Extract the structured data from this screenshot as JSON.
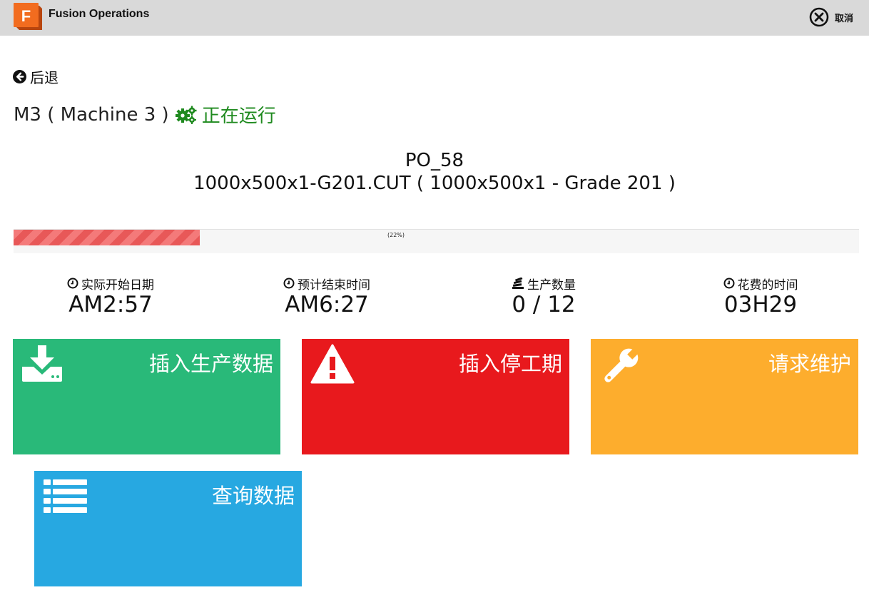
{
  "app": {
    "title": "Fusion Operations",
    "logo_letter": "F",
    "cancel_label": "取消"
  },
  "nav": {
    "back_label": "后退"
  },
  "machine": {
    "name": "M3 ( Machine 3 )",
    "status": "正在运行",
    "status_color": "#1f8a1f"
  },
  "job": {
    "po": "PO_58",
    "file": "1000x500x1-G201.CUT ( 1000x500x1 - Grade 201 )"
  },
  "progress": {
    "percent": 22,
    "text": "(22%)"
  },
  "stats": [
    {
      "icon": "clock-icon",
      "label": "实际开始日期",
      "value": "AM2:57"
    },
    {
      "icon": "clock-icon",
      "label": "预计结束时间",
      "value": "AM6:27"
    },
    {
      "icon": "stack-icon",
      "label": "生产数量",
      "value": "0 / 12"
    },
    {
      "icon": "clock-icon",
      "label": "花费的时间",
      "value": "03H29"
    }
  ],
  "tiles": [
    {
      "label": "插入生产数据",
      "icon": "download-icon",
      "color": "#29b979"
    },
    {
      "label": "插入停工期",
      "icon": "warning-icon",
      "color": "#e8191d"
    },
    {
      "label": "请求维护",
      "icon": "wrench-icon",
      "color": "#fdad2d"
    },
    {
      "label": "查询数据",
      "icon": "list-icon",
      "color": "#27a8e1"
    }
  ]
}
